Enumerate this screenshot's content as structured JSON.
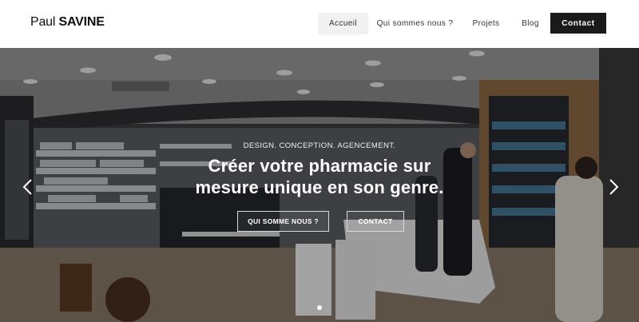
{
  "brand": {
    "name_part1": "Paul ",
    "name_part2": "SAVINE"
  },
  "nav": {
    "items": [
      {
        "label": "Accueil",
        "active": true
      },
      {
        "label": "Qui sommes nous ?"
      },
      {
        "label": "Projets"
      },
      {
        "label": "Blog"
      }
    ],
    "contact_label": "Contact"
  },
  "hero": {
    "tagline": "DESIGN. CONCEPTION. AGENCEMENT.",
    "headline_line1": "Créer votre pharmacie sur",
    "headline_line2": "mesure unique en son genre.",
    "primary_button": "QUI SOMME NOUS ?",
    "secondary_button": "CONTACT",
    "slide_count_visible": 1,
    "prev_icon": "chevron-left-icon",
    "next_icon": "chevron-right-icon"
  },
  "colors": {
    "header_bg": "#ffffff",
    "active_nav_bg": "#f1f1f1",
    "contact_bg": "#1a1a1a",
    "text_dark": "#111111",
    "hero_text": "#ffffff"
  }
}
